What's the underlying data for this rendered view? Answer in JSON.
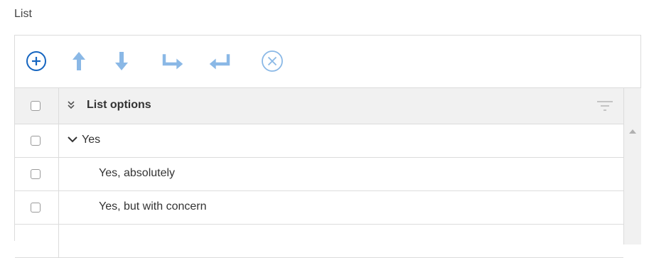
{
  "field": {
    "label": "List"
  },
  "toolbar": {
    "buttons": [
      {
        "name": "add",
        "icon": "plus-circle-icon",
        "color": "#1565c0"
      },
      {
        "name": "move-up",
        "icon": "arrow-up-icon",
        "color": "#8ab8e6"
      },
      {
        "name": "move-down",
        "icon": "arrow-down-icon",
        "color": "#8ab8e6"
      },
      {
        "name": "indent",
        "icon": "indent-arrow-icon",
        "color": "#8ab8e6"
      },
      {
        "name": "outdent",
        "icon": "outdent-arrow-icon",
        "color": "#8ab8e6"
      },
      {
        "name": "remove",
        "icon": "x-circle-icon",
        "color": "#8ab8e6"
      }
    ]
  },
  "grid": {
    "header": {
      "title": "List options",
      "expand_icon": "double-chevron-down-icon",
      "filter_icon": "filter-icon"
    },
    "rows": [
      {
        "label": "Yes",
        "level": 0,
        "expanded": true,
        "checked": false
      },
      {
        "label": "Yes, absolutely",
        "level": 1,
        "checked": false
      },
      {
        "label": "Yes, but with concern",
        "level": 1,
        "checked": false
      }
    ]
  },
  "colors": {
    "primary": "#1565c0",
    "disabled_icon": "#8ab8e6",
    "header_bg": "#f1f1f1",
    "border": "#dcdcdc"
  }
}
